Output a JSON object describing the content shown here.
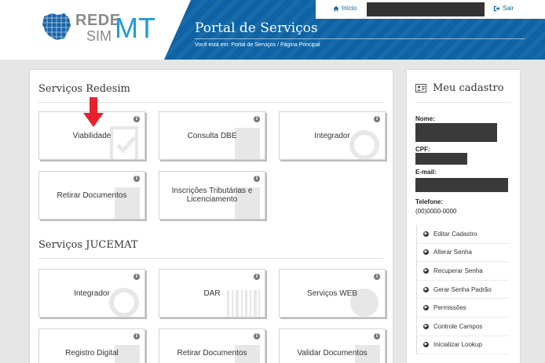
{
  "logo": {
    "rede": "REDE",
    "sim": "SIM",
    "mt": "MT"
  },
  "header": {
    "title": "Portal de Serviços",
    "breadcrumb": "Você está em: Portal de Serviços / Página Principal"
  },
  "topbar": {
    "inicio": "Início",
    "sair": "Sair"
  },
  "sections": {
    "redesim": {
      "title": "Serviços Redesim",
      "tiles": [
        {
          "label": "Viabilidade"
        },
        {
          "label": "Consulta DBE"
        },
        {
          "label": "Integrador"
        },
        {
          "label": "Retirar Documentos"
        },
        {
          "label": "Inscrições Tributárias e Licenciamento"
        }
      ]
    },
    "jucemat": {
      "title": "Serviços JUCEMAT",
      "tiles": [
        {
          "label": "Integrador"
        },
        {
          "label": "DAR"
        },
        {
          "label": "Serviços WEB"
        },
        {
          "label": "Registro Digital"
        },
        {
          "label": "Retirar Documentos"
        },
        {
          "label": "Validar Documentos"
        }
      ]
    }
  },
  "cadastro": {
    "title": "Meu cadastro",
    "nome_label": "Nome:",
    "cpf_label": "CPF:",
    "email_label": "E-mail:",
    "telefone_label": "Telefone:",
    "telefone_value": "(00)0000-0000",
    "menu": [
      {
        "label": "Editar Cadastro"
      },
      {
        "label": "Alterar Senha"
      },
      {
        "label": "Recuperar Senha"
      },
      {
        "label": "Gerar Senha Padrão"
      },
      {
        "label": "Permissões"
      },
      {
        "label": "Controle Campos"
      },
      {
        "label": "Inicializar Lookup"
      }
    ]
  },
  "icons": {
    "info": "info-icon",
    "home": "home-icon",
    "logout": "sign-out-icon",
    "card": "id-card-icon",
    "menu": "arrow-circle-right-icon"
  },
  "colors": {
    "header_blue": "#0d63a5",
    "logo_blue": "#1f9ad6",
    "arrow_red": "#e8222c"
  }
}
